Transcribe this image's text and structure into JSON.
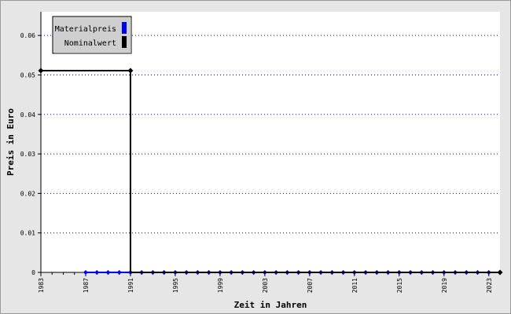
{
  "chart_data": {
    "type": "line",
    "title": "",
    "xlabel": "Zeit in Jahren",
    "ylabel": "Preis in Euro",
    "xlim": [
      1983,
      2024
    ],
    "ylim": [
      0,
      0.066
    ],
    "xticks": [
      1983,
      1987,
      1991,
      1995,
      1999,
      2003,
      2007,
      2011,
      2015,
      2019,
      2023
    ],
    "yticks": [
      0,
      0.01,
      0.02,
      0.03,
      0.04,
      0.05,
      0.06
    ],
    "ytick_labels": [
      "0",
      "0.01",
      "0.02",
      "0.03",
      "0.04",
      "0.05",
      "0.06"
    ],
    "grid": "horizontal dotted",
    "legend_position": "top-left",
    "series": [
      {
        "name": "Materialpreis",
        "color": "#0000ff",
        "marker": "diamond",
        "x": [
          1987,
          1988,
          1989,
          1990,
          1991,
          1992,
          1993,
          1994,
          1995,
          1996,
          1997,
          1998,
          1999,
          2000,
          2001,
          2002,
          2003,
          2004,
          2005,
          2006,
          2007,
          2008,
          2009,
          2010,
          2011,
          2012,
          2013,
          2014,
          2015,
          2016,
          2017,
          2018,
          2019,
          2020,
          2021,
          2022,
          2023,
          2024
        ],
        "y": [
          0,
          0,
          0,
          0,
          0,
          0,
          0,
          0,
          0,
          0,
          0,
          0,
          0,
          0,
          0,
          0,
          0,
          0,
          0,
          0,
          0,
          0,
          0,
          0,
          0,
          0,
          0,
          0,
          0,
          0,
          0,
          0,
          0,
          0,
          0,
          0,
          0,
          0
        ]
      },
      {
        "name": "Nominalwert",
        "color": "#000000",
        "marker": "diamond",
        "step": true,
        "x": [
          1983,
          1991,
          1991,
          2024
        ],
        "y": [
          0.0511,
          0.0511,
          0,
          0
        ],
        "marker_x": [
          1983,
          1991,
          2024
        ],
        "marker_y": [
          0.0511,
          0.0511,
          0
        ]
      }
    ]
  }
}
